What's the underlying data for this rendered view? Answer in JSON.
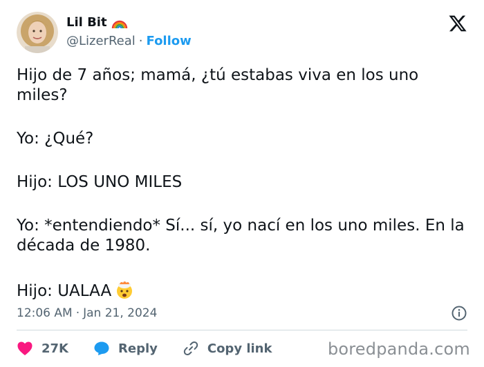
{
  "user": {
    "name": "Lil Bit",
    "handle": "@LizerReal",
    "separator": "·",
    "follow_label": "Follow",
    "badge_icon": "rainbow-icon"
  },
  "tweet": {
    "lines": [
      "Hijo de 7 años; mamá, ¿tú estabas viva en los uno miles?",
      "Yo: ¿Qué?",
      "Hijo: LOS UNO MILES",
      "Yo: *entendiendo* Sí... sí, yo nací en los uno miles. En la década de 1980.",
      "Hijo: UALAA"
    ],
    "emoji_icon": "exploding-head-emoji"
  },
  "meta": {
    "time": "12:06 AM",
    "separator": "·",
    "date": "Jan 21, 2024"
  },
  "actions": {
    "like_count": "27K",
    "reply_label": "Reply",
    "copy_label": "Copy link"
  },
  "watermark": "boredpanda.com",
  "colors": {
    "accent": "#1d9bf0",
    "like": "#f91880",
    "text": "#0f1419",
    "muted": "#536471"
  }
}
